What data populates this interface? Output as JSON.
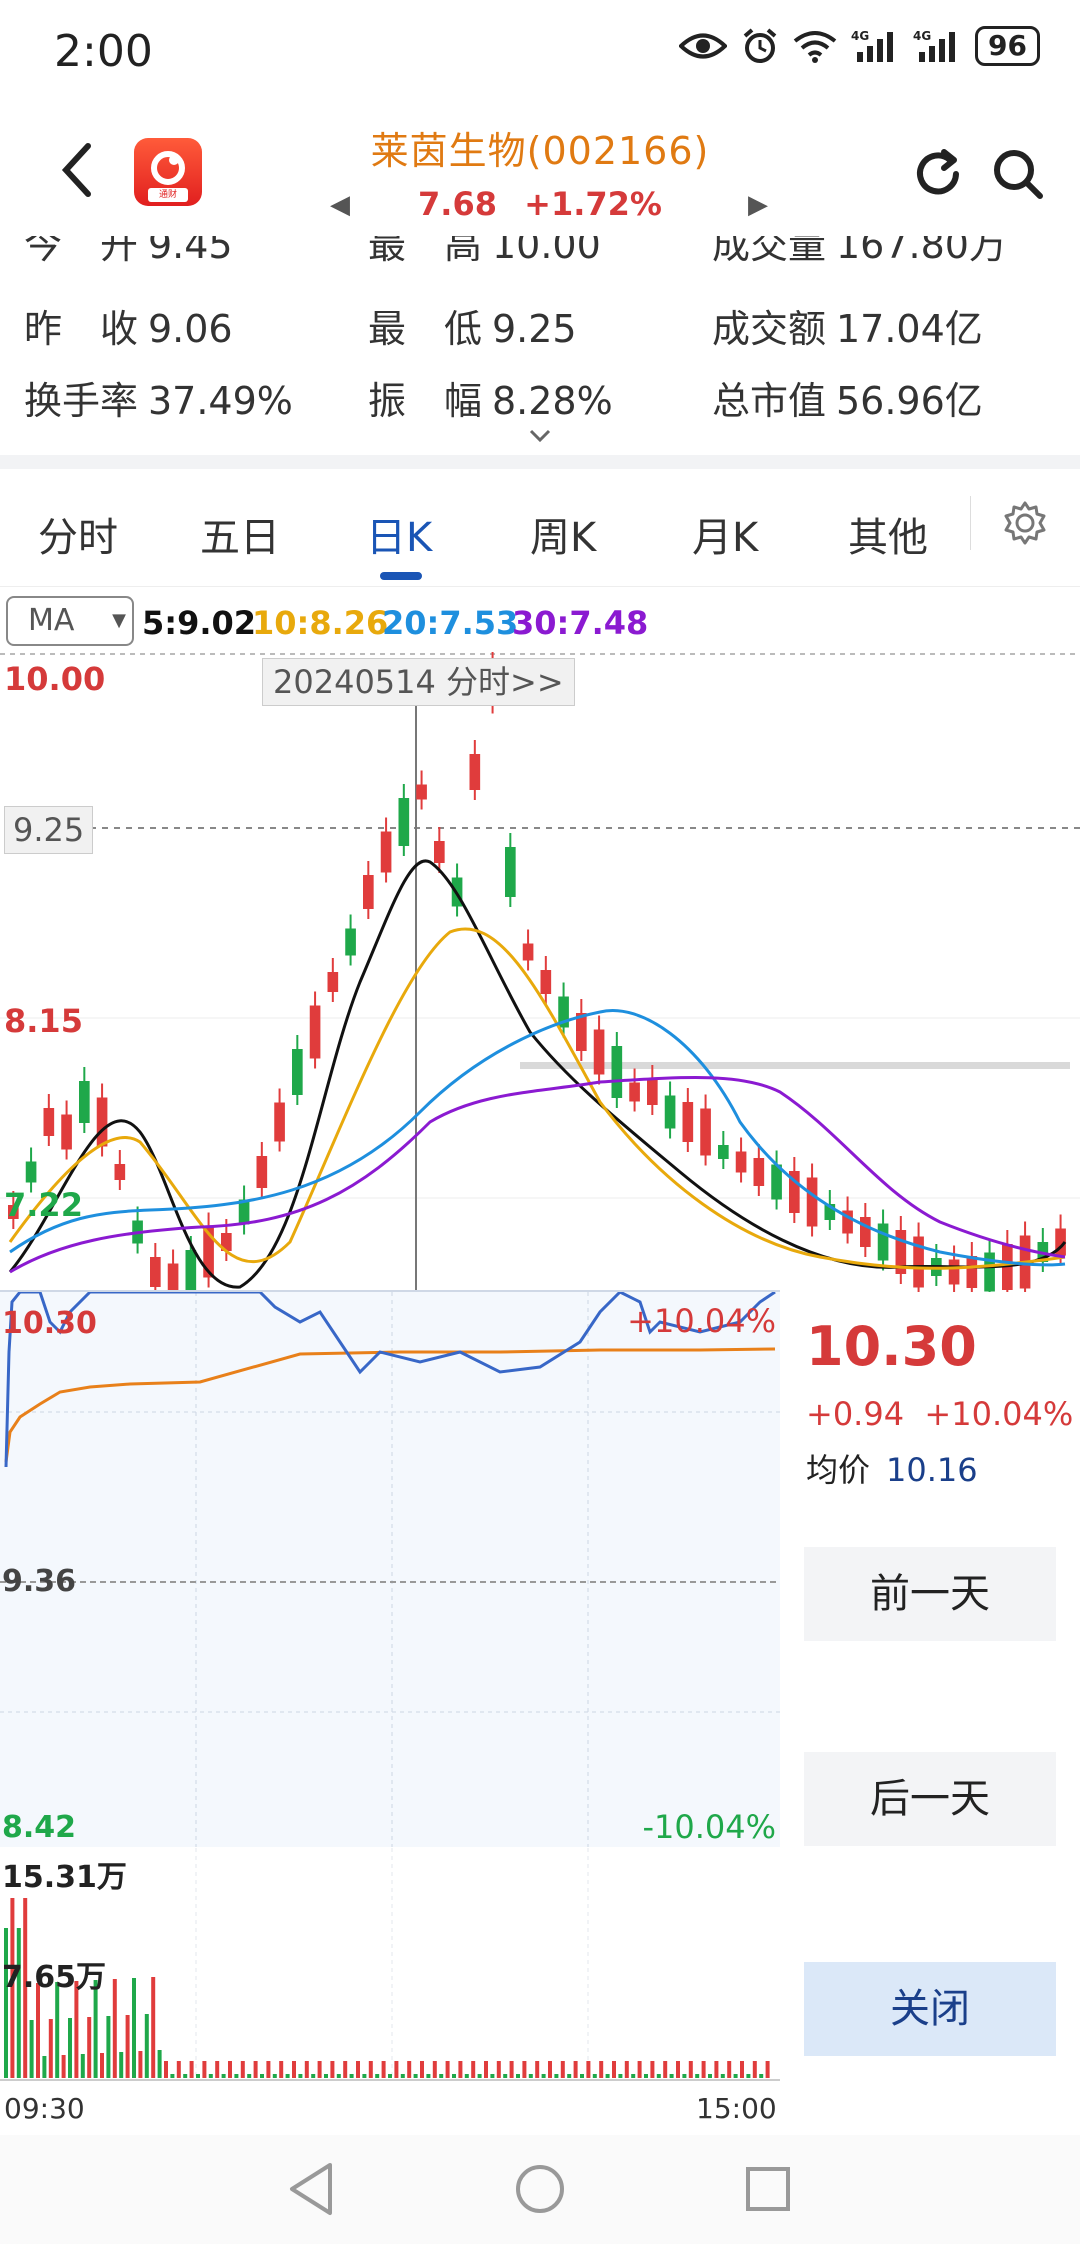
{
  "status_bar": {
    "time": "2:00",
    "battery": "96",
    "net1": "4G",
    "net2": "4G"
  },
  "header": {
    "title": "莱茵生物(002166)",
    "price": "7.68",
    "change_pct": "+1.72%",
    "app_badge": "通财"
  },
  "info": {
    "row0": [
      {
        "label": "今　开",
        "value": "9.45"
      },
      {
        "label": "最　高",
        "value": "10.00"
      },
      {
        "label": "成交量",
        "value": "167.80万"
      }
    ],
    "row1": [
      {
        "label": "昨　收",
        "value": "9.06"
      },
      {
        "label": "最　低",
        "value": "9.25"
      },
      {
        "label": "成交额",
        "value": "17.04亿"
      }
    ],
    "row2": [
      {
        "label": "换手率",
        "value": "37.49%"
      },
      {
        "label": "振　幅",
        "value": "8.28%"
      },
      {
        "label": "总市值",
        "value": "56.96亿"
      }
    ]
  },
  "tabs": [
    "分时",
    "五日",
    "日K",
    "周K",
    "月K",
    "其他"
  ],
  "active_tab": "日K",
  "ma": {
    "selector": "MA",
    "ma5": "5:9.02",
    "ma10": "10:8.26",
    "ma20": "20:7.53",
    "ma30": "30:7.48",
    "colors": {
      "ma5": "#111111",
      "ma10": "#e8a90c",
      "ma20": "#1e8fde",
      "ma30": "#8b1ad1"
    }
  },
  "kchart": {
    "price_high": "10.00",
    "price_mid": "9.25",
    "price_low": "8.15",
    "price_bottom": "7.22",
    "tooltip": "20240514 分时>>",
    "colors": {
      "up": "#e03c3c",
      "down": "#1fa84a"
    }
  },
  "minute_panel": {
    "top_price": "10.30",
    "top_pct": "+10.04%",
    "mid_price": "9.36",
    "bottom_price": "8.42",
    "bottom_pct": "-10.04%",
    "vol_max": "15.31万",
    "vol_mid": "7.65万",
    "time_start": "09:30",
    "time_end": "15:00"
  },
  "side": {
    "price": "10.30",
    "change": "+0.94",
    "change_pct": "+10.04%",
    "avg_label": "均价",
    "avg_value": "10.16",
    "prev_day": "前一天",
    "next_day": "后一天",
    "close": "关闭"
  }
}
